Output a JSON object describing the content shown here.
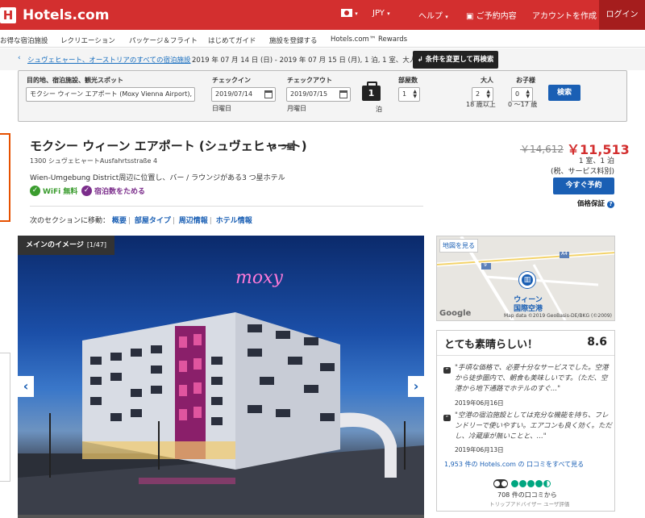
{
  "header": {
    "brand": "Hotels.com",
    "logo_letter": "H",
    "currency": "JPY",
    "help": "ヘルプ",
    "my_bookings": "ご予約内容",
    "create_account": "アカウントを作成",
    "login": "ログイン"
  },
  "subnav": {
    "items": [
      "お得な宿泊施設",
      "レクリエーション",
      "パッケージ＆フライト",
      "はじめてガイド",
      "施設を登録する",
      "Hotels.com™ Rewards"
    ]
  },
  "breadcrumb": {
    "link": "シュヴェヒャート、オーストリアのすべての宿泊施設",
    "summary": "2019 年 07 月 14 日 (日) - 2019 年 07 月 15 日 (月), 1 泊, 1 室、大人 2 名、",
    "change_button": "条件を変更して再検索"
  },
  "search": {
    "destination_label": "目的地、宿泊施設、観光スポット",
    "destination_value": "モクシー ウィーン エアポート (Moxy Vienna Airport), シュ",
    "checkin_label": "チェックイン",
    "checkin_value": "2019/07/14",
    "checkin_day": "日曜日",
    "checkout_label": "チェックアウト",
    "checkout_value": "2019/07/15",
    "checkout_day": "月曜日",
    "nights": "1",
    "nights_unit": "泊",
    "rooms_label": "部屋数",
    "rooms_value": "1",
    "adults_label": "大人",
    "adults_value": "2",
    "adults_note": "18 歳以上",
    "children_label": "お子様",
    "children_value": "0",
    "children_note": "0 ～17 歳",
    "search_button": "検索"
  },
  "hotel": {
    "name": "モクシー ウィーン エアポート (シュヴェヒャート)",
    "stars": "3 つ星",
    "address": "1300 シュヴェヒャートAusfahrtsstraße 4",
    "description": "Wien-Umgebung District周辺に位置し、バー / ラウンジがある3 つ星ホテル",
    "wifi": "WiFi 無料",
    "rewards": "宿泊数をためる"
  },
  "price": {
    "old": "￥14,612",
    "new": "￥11,513",
    "unit": "1 室、1 泊",
    "tax": "(税、サービス料別)",
    "book_button": "今すぐ予約",
    "guarantee": "価格保証"
  },
  "sections": {
    "prefix": "次のセクションに移動：",
    "links": [
      "概要",
      "部屋タイプ",
      "周辺情報",
      "ホテル情報"
    ]
  },
  "photo": {
    "label": "メインのイメージ",
    "counter": "[1/47]",
    "sign": "moxy"
  },
  "map": {
    "button": "地図を見る",
    "place": "ウィーン\n国際空港",
    "credit": "Map data ©2019 GeoBasis-DE/BKG (©2009)",
    "google": "Google",
    "road_a4": "A4",
    "road_9": "9"
  },
  "review": {
    "title": "とても素晴らしい！",
    "score": "8.6",
    "quotes": [
      {
        "text": "\"手頃な価格で、必要十分なサービスでした。空港から徒歩圏内で、朝食も美味しいです。（ただ、空港から地下通路でホテルのすぐ...\"",
        "date": "2019年06月16日"
      },
      {
        "text": "\"空港の宿泊施設としては充分な機能を持ち、フレンドリーで使いやすい。エアコンも良く効く。ただし、冷蔵庫が無いことと、...\"",
        "date": "2019年06月13日"
      }
    ],
    "all_link": "1,953 件の Hotels.com の 口コミをすべて見る",
    "ta_count": "708 件の口コミから",
    "ta_sub": "トリップアドバイザー ユーザ評価",
    "ta_rating": 4.5
  },
  "colors": {
    "brand_red": "#d32f2f",
    "link_blue": "#1a5fb4",
    "price_red": "#d32f2f",
    "wifi_green": "#3a9c2e",
    "rewards_purple": "#7b2d8b"
  }
}
